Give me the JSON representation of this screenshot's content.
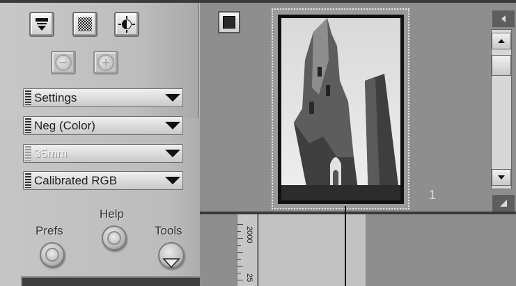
{
  "toolbar": {
    "icons": [
      "filter-icon",
      "checkerboard-icon",
      "contrast-icon"
    ],
    "zoom": [
      "zoom-out-icon",
      "zoom-in-icon"
    ]
  },
  "dropdowns": [
    {
      "value": "Settings",
      "enabled": true
    },
    {
      "value": "Neg (Color)",
      "enabled": true
    },
    {
      "value": "35mm",
      "enabled": false
    },
    {
      "value": "Calibrated RGB",
      "enabled": true
    }
  ],
  "buttons": {
    "prefs": "Prefs",
    "help": "Help",
    "tools": "Tools"
  },
  "preview": {
    "frame_number": "1"
  },
  "ruler": {
    "marks": [
      "2000",
      "25"
    ]
  },
  "colors": {
    "panel": "#bcbcbc",
    "strip": "#8e8e8e",
    "film": "#111111"
  }
}
